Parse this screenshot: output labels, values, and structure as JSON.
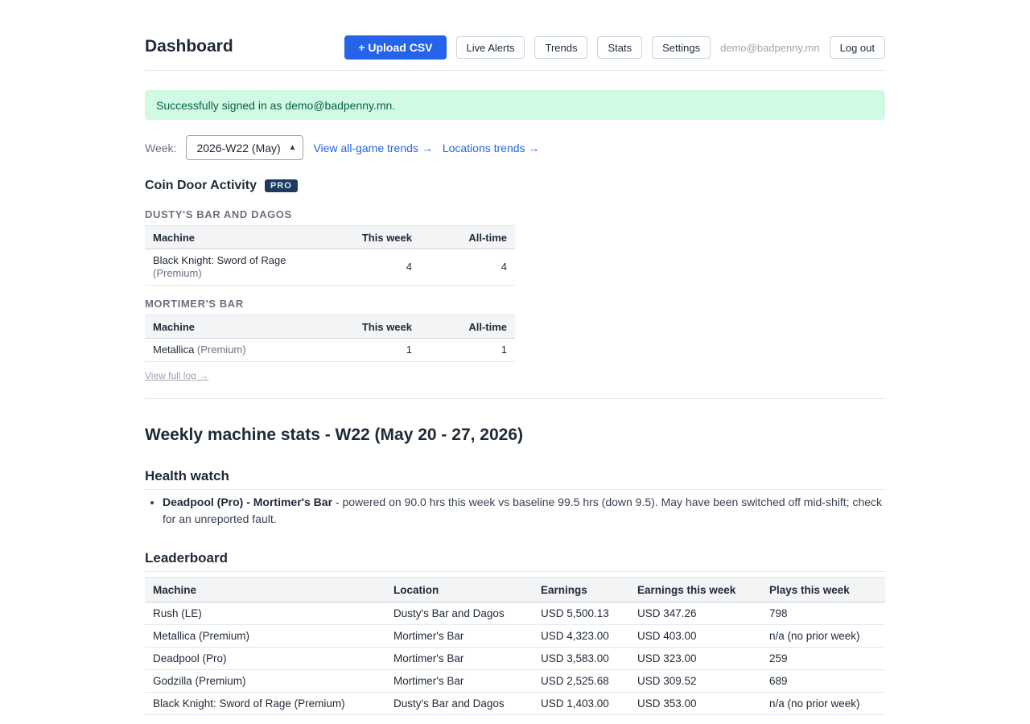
{
  "header": {
    "title": "Dashboard",
    "upload_label": "+ Upload CSV",
    "nav": [
      "Live Alerts",
      "Trends",
      "Stats",
      "Settings"
    ],
    "user_email": "demo@badpenny.mn",
    "logout_label": "Log out"
  },
  "flash": "Successfully signed in as demo@badpenny.mn.",
  "week": {
    "label": "Week:",
    "selected": "2026-W22 (May)",
    "link_all_game": "View all-game trends →",
    "link_locations": "Locations trends →"
  },
  "coin_door": {
    "title": "Coin Door Activity",
    "badge": "PRO",
    "columns": [
      "Machine",
      "This week",
      "All-time"
    ],
    "locations": [
      {
        "name": "DUSTY'S BAR AND DAGOS",
        "rows": [
          {
            "machine": "Black Knight: Sword of Rage",
            "edition": "(Premium)",
            "this_week": "4",
            "all_time": "4"
          }
        ]
      },
      {
        "name": "MORTIMER'S BAR",
        "rows": [
          {
            "machine": "Metallica",
            "edition": "(Premium)",
            "this_week": "1",
            "all_time": "1"
          }
        ]
      }
    ],
    "full_log_link": "View full log →"
  },
  "weekly": {
    "title": "Weekly machine stats - W22 (May 20 - 27, 2026)",
    "health": {
      "title": "Health watch",
      "items": [
        {
          "subject": "Deadpool (Pro) - Mortimer's Bar",
          "text": " - powered on 90.0 hrs this week vs baseline 99.5 hrs (down 9.5). May have been switched off mid-shift; check for an unreported fault."
        }
      ]
    },
    "leaderboard": {
      "title": "Leaderboard",
      "columns": [
        "Machine",
        "Location",
        "Earnings",
        "Earnings this week",
        "Plays this week"
      ],
      "rows": [
        [
          "Rush (LE)",
          "Dusty's Bar and Dagos",
          "USD 5,500.13",
          "USD 347.26",
          "798"
        ],
        [
          "Metallica (Premium)",
          "Mortimer's Bar",
          "USD 4,323.00",
          "USD 403.00",
          "n/a (no prior week)"
        ],
        [
          "Deadpool (Pro)",
          "Mortimer's Bar",
          "USD 3,583.00",
          "USD 323.00",
          "259"
        ],
        [
          "Godzilla (Premium)",
          "Mortimer's Bar",
          "USD 2,525.68",
          "USD 309.52",
          "689"
        ],
        [
          "Black Knight: Sword of Rage (Premium)",
          "Dusty's Bar and Dagos",
          "USD 1,403.00",
          "USD 353.00",
          "n/a (no prior week)"
        ]
      ]
    }
  }
}
